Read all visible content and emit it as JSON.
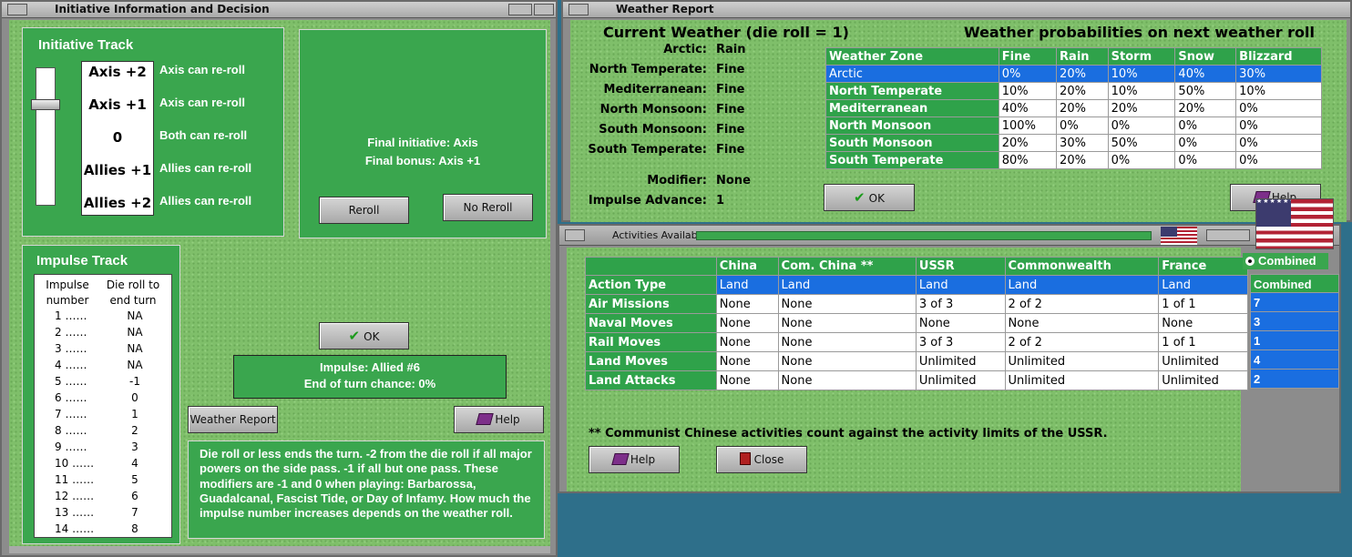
{
  "initiative_window": {
    "title": "Initiative Information and Decision",
    "initiative_track": {
      "heading": "Initiative Track",
      "values": [
        "Axis +2",
        "Axis +1",
        "0",
        "Allies +1",
        "Allies +2"
      ],
      "descriptions": [
        "Axis can re-roll",
        "Axis can re-roll",
        "Both can re-roll",
        "Allies can re-roll",
        "Allies can re-roll"
      ],
      "slider_marker": "Axis +1"
    },
    "decision": {
      "final_initiative": "Final initiative: Axis",
      "final_bonus": "Final bonus: Axis +1",
      "reroll": "Reroll",
      "no_reroll": "No Reroll"
    },
    "impulse_track": {
      "heading": "Impulse Track",
      "col1": "Impulse number",
      "col2": "Die roll to end turn",
      "rows": [
        [
          "1 ……",
          "NA"
        ],
        [
          "2 ……",
          "NA"
        ],
        [
          "3 ……",
          "NA"
        ],
        [
          "4 ……",
          "NA"
        ],
        [
          "5 ……",
          "-1"
        ],
        [
          "6 ……",
          "0"
        ],
        [
          "7 ……",
          "1"
        ],
        [
          "8 ……",
          "2"
        ],
        [
          "9 ……",
          "3"
        ],
        [
          "10 ……",
          "4"
        ],
        [
          "11 ……",
          "5"
        ],
        [
          "12 ……",
          "6"
        ],
        [
          "13 ……",
          "7"
        ],
        [
          "14 ……",
          "8"
        ]
      ]
    },
    "ok": "OK",
    "impulse_status": "Impulse: Allied #6",
    "end_of_turn": "End of turn chance: 0%",
    "weather_report_button": "Weather Report",
    "help": "Help",
    "note": "Die roll or less ends the turn.  -2 from the die roll if all major powers on the side pass.  -1 if all but one pass.  These modifiers are -1 and 0 when playing: Barbarossa, Guadalcanal, Fascist Tide, or Day of Infamy.  How much the impulse number increases depends on the weather roll."
  },
  "weather_window": {
    "title": "Weather Report",
    "current": "Current Weather (die roll = 1)",
    "prob_heading": "Weather probabilities on next weather roll",
    "zones": [
      {
        "zone": "Arctic:",
        "w": "Rain"
      },
      {
        "zone": "North Temperate:",
        "w": "Fine"
      },
      {
        "zone": "Mediterranean:",
        "w": "Fine"
      },
      {
        "zone": "North Monsoon:",
        "w": "Fine"
      },
      {
        "zone": "South Monsoon:",
        "w": "Fine"
      },
      {
        "zone": "South Temperate:",
        "w": "Fine"
      }
    ],
    "modifier_label": "Modifier:",
    "modifier": "None",
    "impulse_adv_label": "Impulse Advance:",
    "impulse_adv": "1",
    "table_headers": [
      "Weather Zone",
      "Fine",
      "Rain",
      "Storm",
      "Snow",
      "Blizzard"
    ],
    "table_rows": [
      [
        "Arctic",
        "0%",
        "20%",
        "10%",
        "40%",
        "30%"
      ],
      [
        "North Temperate",
        "10%",
        "20%",
        "10%",
        "50%",
        "10%"
      ],
      [
        "Mediterranean",
        "40%",
        "20%",
        "20%",
        "20%",
        "0%"
      ],
      [
        "North Monsoon",
        "100%",
        "0%",
        "0%",
        "0%",
        "0%"
      ],
      [
        "South Monsoon",
        "20%",
        "30%",
        "50%",
        "0%",
        "0%"
      ],
      [
        "South Temperate",
        "80%",
        "20%",
        "0%",
        "0%",
        "0%"
      ]
    ],
    "ok": "OK",
    "help": "Help"
  },
  "activities_window": {
    "title": "Activities Available",
    "headers": [
      "",
      "China",
      "Com. China **",
      "USSR",
      "Commonwealth",
      "France"
    ],
    "rows": [
      [
        "Action Type",
        "Land",
        "Land",
        "Land",
        "Land",
        "Land"
      ],
      [
        "Air Missions",
        "None",
        "None",
        "3 of 3",
        "2 of 2",
        "1 of 1"
      ],
      [
        "Naval Moves",
        "None",
        "None",
        "None",
        "None",
        "None"
      ],
      [
        "Rail Moves",
        "None",
        "None",
        "3 of 3",
        "2 of 2",
        "1 of 1"
      ],
      [
        "Land Moves",
        "None",
        "None",
        "Unlimited",
        "Unlimited",
        "Unlimited"
      ],
      [
        "Land Attacks",
        "None",
        "None",
        "Unlimited",
        "Unlimited",
        "Unlimited"
      ]
    ],
    "combined": {
      "radio_label": "Combined",
      "header": "Combined",
      "values": [
        "7",
        "3",
        "1",
        "4",
        "2"
      ]
    },
    "footnote": "** Communist Chinese activities count against the activity limits of the USSR.",
    "help": "Help",
    "close": "Close"
  },
  "colors": {
    "felt": "#7fbf6a",
    "panel": "#3aa64e",
    "selection": "#1a6ee0"
  }
}
